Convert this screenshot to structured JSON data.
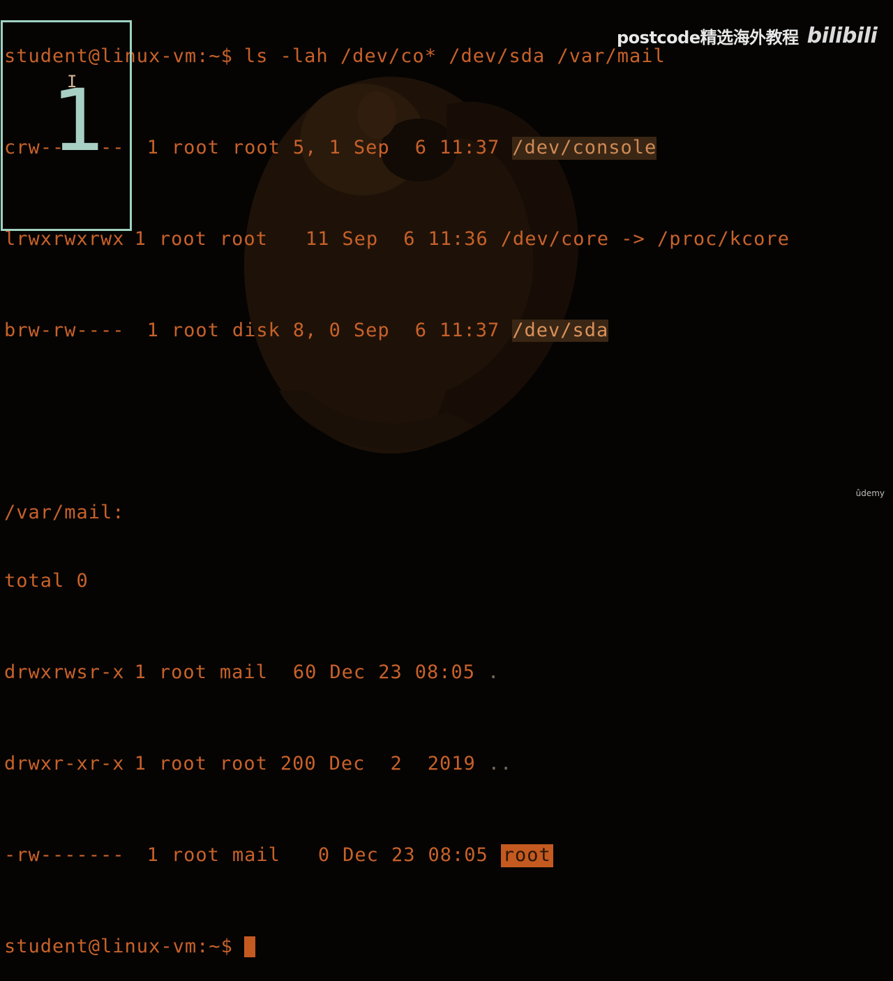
{
  "terminal": {
    "prompt": "student@linux-vm:~$",
    "command": "ls -lah /dev/co* /dev/sda /var/mail",
    "dev_rows": [
      {
        "perms": "crw-------",
        "links": "1",
        "owner": "root",
        "group": "root",
        "size": "5, 1",
        "month": "Sep",
        "day": "6",
        "time": "11:37",
        "name": "/dev/console",
        "highlight": "console"
      },
      {
        "perms": "lrwxrwxrwx",
        "links": "1",
        "owner": "root",
        "group": "root",
        "size": "11",
        "month": "Sep",
        "day": "6",
        "time": "11:36",
        "name": "/dev/core -> /proc/kcore",
        "highlight": "link"
      },
      {
        "perms": "brw-rw----",
        "links": "1",
        "owner": "root",
        "group": "disk",
        "size": "8, 0",
        "month": "Sep",
        "day": "6",
        "time": "11:37",
        "name": "/dev/sda",
        "highlight": "sda"
      }
    ],
    "dir_header": "/var/mail:",
    "total": "total 0",
    "mail_rows": [
      {
        "perms": "drwxrwsr-x",
        "links": "1",
        "owner": "root",
        "group": "mail",
        "size": "60",
        "month": "Dec",
        "day": "23",
        "time": "08:05",
        "name": ".",
        "highlight": "dim"
      },
      {
        "perms": "drwxr-xr-x",
        "links": "1",
        "owner": "root",
        "group": "root",
        "size": "200",
        "month": "Dec",
        "day": "2",
        "time": "2019",
        "name": "..",
        "highlight": "dim"
      },
      {
        "perms": "-rw-------",
        "links": "1",
        "owner": "root",
        "group": "mail",
        "size": "0",
        "month": "Dec",
        "day": "23",
        "time": "08:05",
        "name": "root",
        "highlight": "root"
      }
    ],
    "final_prompt": "student@linux-vm:~$"
  },
  "annotation": {
    "number": "1"
  },
  "watermark": {
    "text": "postcode精选海外教程",
    "brand": "bilibili"
  },
  "corner_brand": "ûdemy",
  "colors": {
    "terminal_text": "#c8612a",
    "highlight_bg": "#c45a20",
    "box_border": "#9fd2c2"
  }
}
